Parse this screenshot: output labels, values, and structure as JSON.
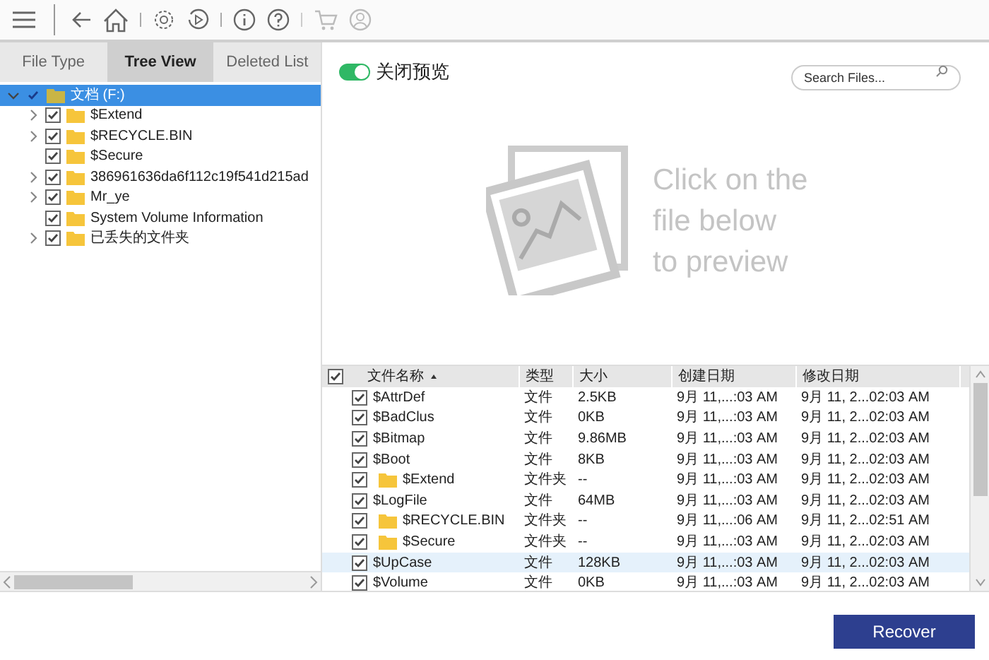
{
  "tabs": [
    {
      "label": "File Type",
      "selected": false
    },
    {
      "label": "Tree View",
      "selected": true
    },
    {
      "label": "Deleted List",
      "selected": false
    }
  ],
  "tree": [
    {
      "label": "文档 (F:)",
      "checked": true,
      "expanded": true,
      "selected": true,
      "children": [
        {
          "label": "$Extend",
          "checked": true,
          "has_children": true
        },
        {
          "label": "$RECYCLE.BIN",
          "checked": true,
          "has_children": true
        },
        {
          "label": "$Secure",
          "checked": true,
          "has_children": false
        },
        {
          "label": "386961636da6f112c19f541d215ad",
          "checked": true,
          "has_children": true
        },
        {
          "label": "Mr_ye",
          "checked": true,
          "has_children": true
        },
        {
          "label": "System Volume Information",
          "checked": true,
          "has_children": false
        },
        {
          "label": "已丢失的文件夹",
          "checked": true,
          "has_children": true
        }
      ]
    }
  ],
  "preview_toggle": {
    "label": "关闭预览",
    "on": true
  },
  "search": {
    "placeholder": "Search Files..."
  },
  "preview_hint": [
    "Click on the",
    "file below",
    "to preview"
  ],
  "table": {
    "all_checked": true,
    "columns": [
      "文件名称",
      "类型",
      "大小",
      "创建日期",
      "修改日期"
    ],
    "rows": [
      {
        "kind": "file",
        "checked": true,
        "selected": false,
        "cells": [
          "$AttrDef",
          "文件",
          "2.5KB",
          "9月 11,...:03 AM",
          "9月 11, 2...02:03 AM"
        ]
      },
      {
        "kind": "file",
        "checked": true,
        "selected": false,
        "cells": [
          "$BadClus",
          "文件",
          "0KB",
          "9月 11,...:03 AM",
          "9月 11, 2...02:03 AM"
        ]
      },
      {
        "kind": "file",
        "checked": true,
        "selected": false,
        "cells": [
          "$Bitmap",
          "文件",
          "9.86MB",
          "9月 11,...:03 AM",
          "9月 11, 2...02:03 AM"
        ]
      },
      {
        "kind": "file",
        "checked": true,
        "selected": false,
        "cells": [
          "$Boot",
          "文件",
          "8KB",
          "9月 11,...:03 AM",
          "9月 11, 2...02:03 AM"
        ]
      },
      {
        "kind": "folder",
        "checked": true,
        "selected": false,
        "cells": [
          "$Extend",
          "文件夹",
          "--",
          "9月 11,...:03 AM",
          "9月 11, 2...02:03 AM"
        ]
      },
      {
        "kind": "file",
        "checked": true,
        "selected": false,
        "cells": [
          "$LogFile",
          "文件",
          "64MB",
          "9月 11,...:03 AM",
          "9月 11, 2...02:03 AM"
        ]
      },
      {
        "kind": "folder",
        "checked": true,
        "selected": false,
        "cells": [
          "$RECYCLE.BIN",
          "文件夹",
          "--",
          "9月 11,...:06 AM",
          "9月 11, 2...02:51 AM"
        ]
      },
      {
        "kind": "folder",
        "checked": true,
        "selected": false,
        "cells": [
          "$Secure",
          "文件夹",
          "--",
          "9月 11,...:03 AM",
          "9月 11, 2...02:03 AM"
        ]
      },
      {
        "kind": "file",
        "checked": true,
        "selected": true,
        "cells": [
          "$UpCase",
          "文件",
          "128KB",
          "9月 11,...:03 AM",
          "9月 11, 2...02:03 AM"
        ]
      },
      {
        "kind": "file",
        "checked": true,
        "selected": false,
        "cells": [
          "$Volume",
          "文件",
          "0KB",
          "9月 11,...:03 AM",
          "9月 11, 2...02:03 AM"
        ]
      }
    ]
  },
  "recover_button": "Recover"
}
